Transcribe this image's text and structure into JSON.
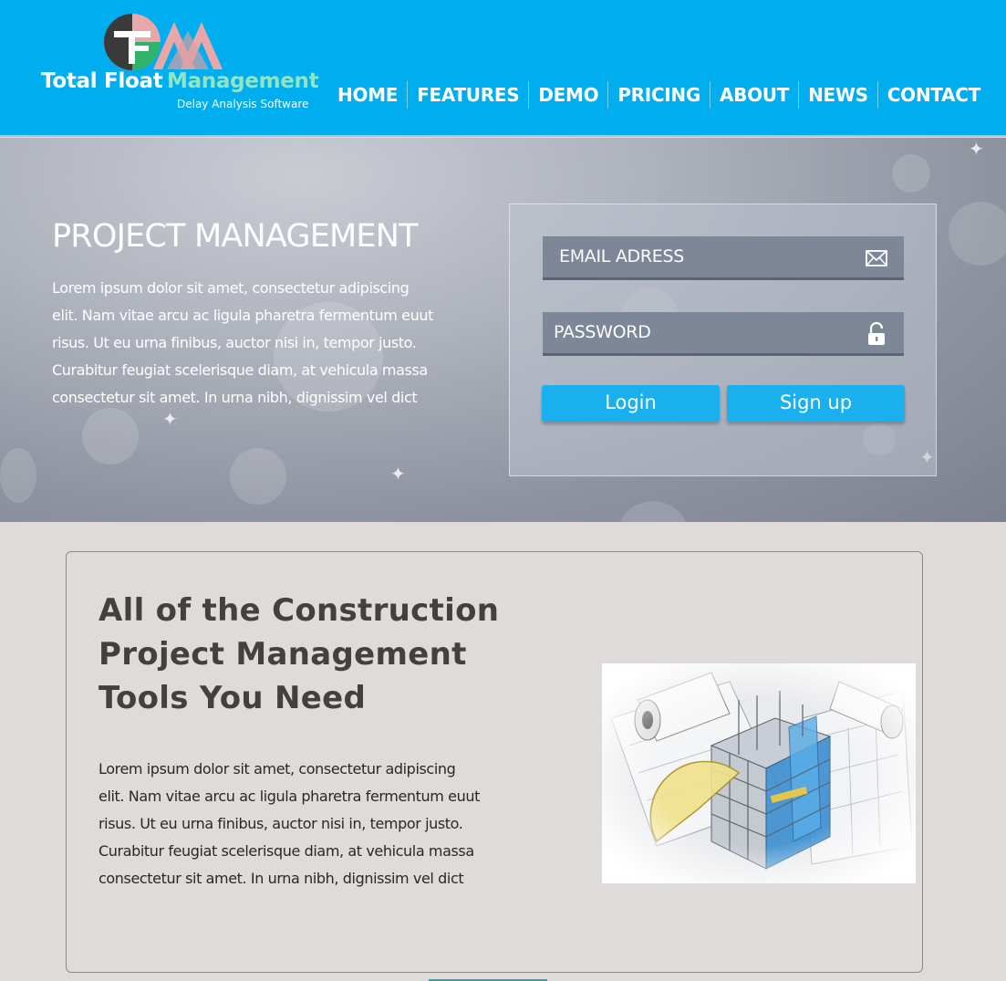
{
  "header": {
    "logo": {
      "word1": "Total Float",
      "word2": "Management",
      "tagline": "Delay Analysis Software",
      "mark_letter": "TF"
    },
    "nav": [
      "HOME",
      "FEATURES",
      "DEMO",
      "PRICING",
      "ABOUT",
      "NEWS",
      "CONTACT"
    ]
  },
  "hero": {
    "title": "PROJECT MANAGEMENT",
    "text": "Lorem ipsum dolor sit amet, consectetur adipiscing elit. Nam vitae arcu ac ligula pharetra fermentum euut risus. Ut eu urna finibus, auctor nisi in, tempor  justo. Curabitur feugiat scelerisque diam, at vehicula massa consectetur sit amet. In urna nibh, dignissim vel dict"
  },
  "login": {
    "email_placeholder": "EMAIL ADRESS",
    "password_placeholder": "PASSWORD",
    "login_label": "Login",
    "signup_label": "Sign up",
    "icons": {
      "email": "envelope-icon",
      "password": "unlock-icon"
    }
  },
  "content": {
    "title_lines": [
      "All of the Construction",
      "Project Management",
      "Tools You Need"
    ],
    "text": "Lorem ipsum dolor sit amet, consectetur adipiscing elit. Nam vitae arcu ac ligula pharetra fermentum euut risus. Ut eu urna finibus, auctor nisi in, tempor  justo. Curabitur feugiat scelerisque diam, at vehicula massa consectetur sit amet. In urna nibh, dignissim vel dict"
  },
  "colors": {
    "header_bg": "#00aeef",
    "accent_green": "#8ee6c4",
    "button_blue": "#1ab0ef",
    "page_bg": "#e0dbdb"
  }
}
